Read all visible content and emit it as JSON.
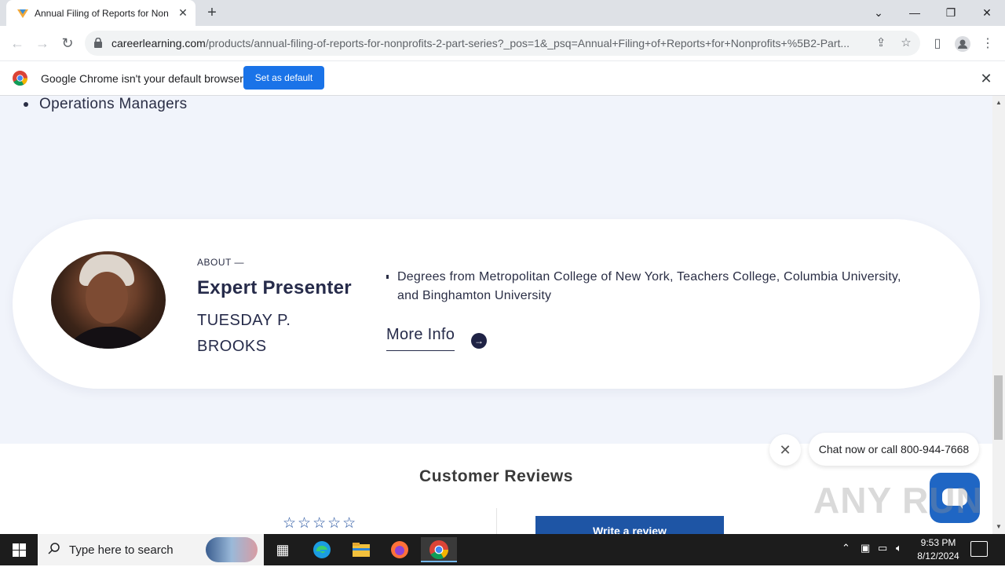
{
  "browser": {
    "tab_title": "Annual Filing of Reports for Non",
    "url_host": "careerlearning.com",
    "url_path": "/products/annual-filing-of-reports-for-nonprofits-2-part-series?_pos=1&_psq=Annual+Filing+of+Reports+for+Nonprofits+%5B2-Part..."
  },
  "infobar": {
    "message": "Google Chrome isn't your default browser",
    "button": "Set as default"
  },
  "page": {
    "bullet": "Operations Managers",
    "presenter": {
      "about": "ABOUT —",
      "title": "Expert Presenter",
      "name": "TUESDAY P. BROOKS",
      "degrees": "Degrees from Metropolitan College of New York, Teachers College, Columbia University, and Binghamton University",
      "more_info": "More Info"
    },
    "reviews": {
      "title": "Customer Reviews",
      "stars": "☆☆☆☆☆",
      "write_review": "Write a review"
    },
    "chat": {
      "bubble": "Chat now or call 800-944-7668"
    },
    "watermark": "ANY RUN"
  },
  "taskbar": {
    "search_placeholder": "Type here to search",
    "time": "9:53 PM",
    "date": "8/12/2024"
  }
}
